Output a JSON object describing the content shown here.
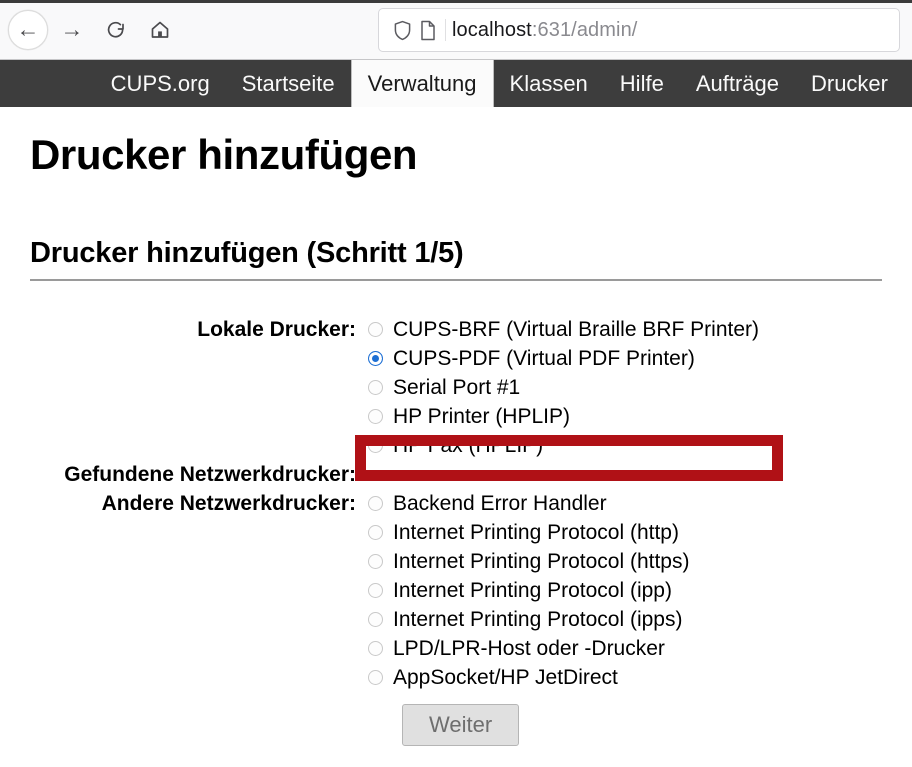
{
  "browser": {
    "back_icon": "arrow-left-icon",
    "forward_icon": "arrow-right-icon",
    "reload_icon": "reload-icon",
    "home_icon": "home-icon",
    "shield_icon": "shield-icon",
    "page_icon": "page-document-icon",
    "url_host": "localhost",
    "url_rest": ":631/admin/"
  },
  "cups_nav": {
    "tabs": [
      {
        "label": "CUPS.org",
        "active": false
      },
      {
        "label": "Startseite",
        "active": false
      },
      {
        "label": "Verwaltung",
        "active": true
      },
      {
        "label": "Klassen",
        "active": false
      },
      {
        "label": "Hilfe",
        "active": false
      },
      {
        "label": "Aufträge",
        "active": false
      },
      {
        "label": "Drucker",
        "active": false
      }
    ]
  },
  "page": {
    "title": "Drucker hinzufügen",
    "section_title": "Drucker hinzufügen (Schritt 1/5)"
  },
  "form": {
    "local_printers": {
      "label": "Lokale Drucker:",
      "options": [
        {
          "label": "CUPS-BRF (Virtual Braille BRF Printer)",
          "selected": false
        },
        {
          "label": "CUPS-PDF (Virtual PDF Printer)",
          "selected": true
        },
        {
          "label": "Serial Port #1",
          "selected": false
        },
        {
          "label": "HP Printer (HPLIP)",
          "selected": false
        },
        {
          "label": "HP Fax (HPLIP)",
          "selected": false
        }
      ]
    },
    "discovered_network_printers": {
      "label": "Gefundene Netzwerkdrucker:",
      "options": []
    },
    "other_network_printers": {
      "label": "Andere Netzwerkdrucker:",
      "options": [
        {
          "label": "Backend Error Handler",
          "selected": false
        },
        {
          "label": "Internet Printing Protocol (http)",
          "selected": false
        },
        {
          "label": "Internet Printing Protocol (https)",
          "selected": false
        },
        {
          "label": "Internet Printing Protocol (ipp)",
          "selected": false
        },
        {
          "label": "Internet Printing Protocol (ipps)",
          "selected": false
        },
        {
          "label": "LPD/LPR-Host oder -Drucker",
          "selected": false
        },
        {
          "label": "AppSocket/HP JetDirect",
          "selected": false
        }
      ]
    },
    "submit_label": "Weiter"
  },
  "annotation": {
    "highlight_color": "#b01116",
    "highlights_option": "CUPS-PDF (Virtual PDF Printer)"
  }
}
